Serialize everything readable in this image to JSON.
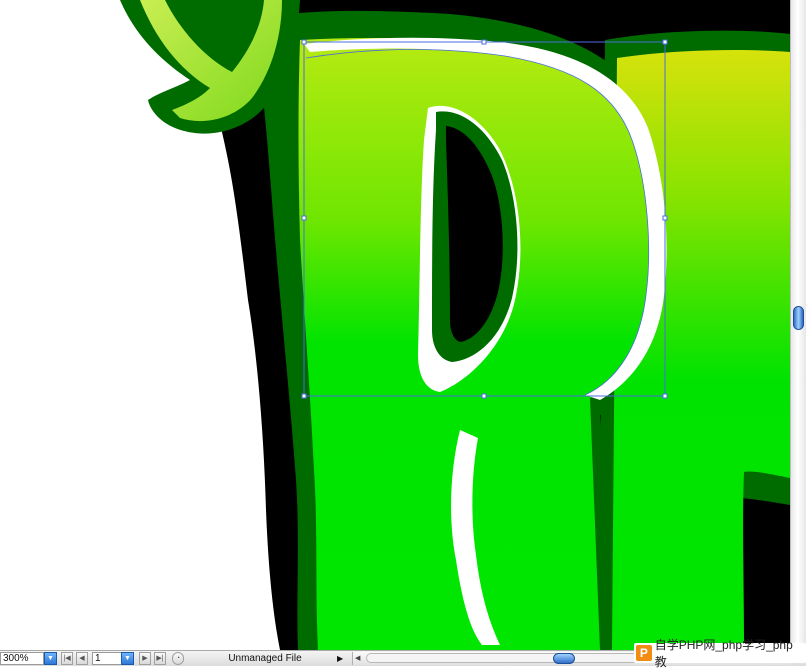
{
  "document": {
    "artwork_letters": "PL",
    "colors": {
      "outer_shadow": "#000000",
      "outer_outline": "#006a00",
      "letter_fill_light": "#d7e60b",
      "letter_fill_mid": "#7fe500",
      "letter_fill_bright": "#00e400",
      "leaf_light": "#c8f05a",
      "highlight": "#ffffff",
      "selection_handles": "#4a6de0"
    }
  },
  "statusbar": {
    "zoom": "300%",
    "artboard_number": "1",
    "file_status": "Unmanaged File"
  },
  "watermark": {
    "logo_letter": "P",
    "text": "自学PHP网_php学习_php教"
  },
  "icons": {
    "zoom_dropdown": "chevron-down-icon",
    "first": "first-artboard-icon",
    "prev": "previous-artboard-icon",
    "artboard_dropdown": "chevron-down-icon",
    "next": "next-artboard-icon",
    "last": "last-artboard-icon",
    "status_menu": "triangle-right-icon",
    "scroll_left": "scroll-left-icon"
  }
}
